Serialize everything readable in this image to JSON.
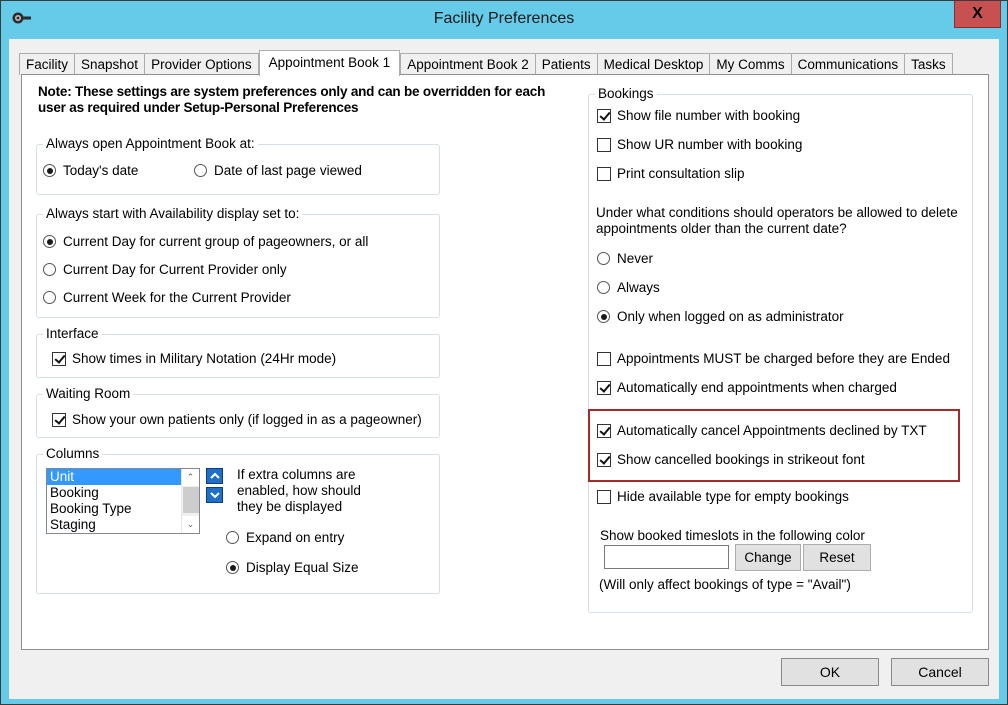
{
  "window": {
    "title": "Facility Preferences",
    "icon": "key-icon",
    "close_label": "X"
  },
  "tabs": [
    {
      "label": "Facility",
      "active": false
    },
    {
      "label": "Snapshot",
      "active": false
    },
    {
      "label": "Provider Options",
      "active": false
    },
    {
      "label": "Appointment Book 1",
      "active": true
    },
    {
      "label": "Appointment Book 2",
      "active": false
    },
    {
      "label": "Patients",
      "active": false
    },
    {
      "label": "Medical Desktop",
      "active": false
    },
    {
      "label": "My Comms",
      "active": false
    },
    {
      "label": "Communications",
      "active": false
    },
    {
      "label": "Tasks",
      "active": false
    }
  ],
  "note": {
    "line1": "Note: These settings are system preferences only and can be overridden for each",
    "line2": "user as required under Setup-Personal Preferences"
  },
  "open_book": {
    "label": "Always open Appointment Book at:",
    "options": [
      {
        "label": "Today's date",
        "selected": true
      },
      {
        "label": "Date of last page viewed",
        "selected": false
      }
    ]
  },
  "availability": {
    "label": "Always start with Availability display set to:",
    "options": [
      {
        "label": "Current Day for current group of pageowners, or all",
        "selected": true
      },
      {
        "label": "Current Day for Current Provider only",
        "selected": false
      },
      {
        "label": "Current Week for the Current Provider",
        "selected": false
      }
    ]
  },
  "interface": {
    "label": "Interface",
    "military_time": {
      "label": "Show times in Military Notation (24Hr mode)",
      "checked": true
    }
  },
  "waiting_room": {
    "label": "Waiting Room",
    "own_patients": {
      "label": "Show your own patients only (if logged in as a pageowner)",
      "checked": true
    }
  },
  "columns": {
    "label": "Columns",
    "items": [
      {
        "label": "Unit",
        "selected": true
      },
      {
        "label": "Booking",
        "selected": false
      },
      {
        "label": "Booking Type",
        "selected": false
      },
      {
        "label": "Staging",
        "selected": false
      }
    ],
    "extra_text_1": "If extra columns are",
    "extra_text_2": "enabled, how should",
    "extra_text_3": "they be displayed",
    "display_options": [
      {
        "label": "Expand on entry",
        "selected": false
      },
      {
        "label": "Display Equal Size",
        "selected": true
      }
    ]
  },
  "bookings": {
    "label": "Bookings",
    "show_file_number": {
      "label": "Show file number with booking",
      "checked": true
    },
    "show_ur_number": {
      "label": "Show UR number with booking",
      "checked": false
    },
    "print_slip": {
      "label": "Print consultation slip",
      "checked": false
    },
    "delete_question_1": "Under what conditions should operators be allowed to delete",
    "delete_question_2": "appointments older than the current date?",
    "delete_options": [
      {
        "label": "Never",
        "selected": false
      },
      {
        "label": "Always",
        "selected": false
      },
      {
        "label": "Only when logged on as administrator",
        "selected": true
      }
    ],
    "must_charge": {
      "label": "Appointments MUST be charged before they are Ended",
      "checked": false
    },
    "auto_end": {
      "label": "Automatically end appointments when charged",
      "checked": true
    },
    "auto_cancel_txt": {
      "label": "Automatically cancel Appointments declined by TXT",
      "checked": true
    },
    "strikeout": {
      "label": "Show cancelled bookings in strikeout font",
      "checked": true
    },
    "hide_available": {
      "label": "Hide available type for empty bookings",
      "checked": false
    },
    "color_label": "Show booked timeslots in the following color",
    "color_value": "",
    "change_label": "Change",
    "reset_label": "Reset",
    "color_note": "(Will only affect bookings of type = \"Avail\")"
  },
  "highlight_color": "#a52a2a",
  "footer": {
    "ok_label": "OK",
    "cancel_label": "Cancel"
  }
}
